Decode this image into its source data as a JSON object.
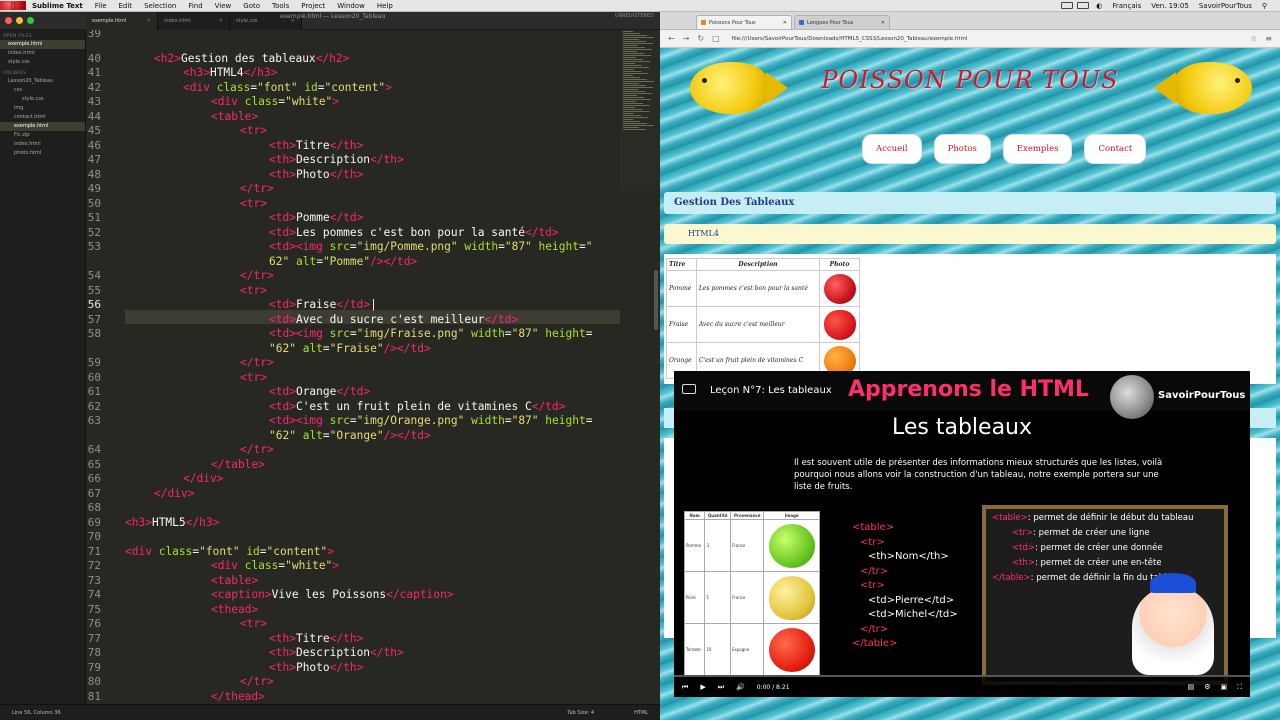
{
  "menubar": {
    "app": "Sublime Text",
    "items": [
      "File",
      "Edit",
      "Selection",
      "Find",
      "View",
      "Goto",
      "Tools",
      "Project",
      "Window",
      "Help"
    ],
    "language": "Français",
    "clock": "Ven. 19:05",
    "user": "SavoirPourTous"
  },
  "sublime": {
    "window_title": "exemple.html — Lesson20_Tableau",
    "unregistered": "UNREGISTERED",
    "tabs": [
      "exemple.html",
      "index.html",
      "style.css"
    ],
    "sidebar": {
      "open_files_label": "OPEN FILES",
      "open_files": [
        "exemple.html",
        "index.html",
        "style.css"
      ],
      "folders_label": "FOLDERS",
      "tree": [
        "Lesson20_Tableau",
        "css",
        "style.css",
        "img",
        "contact.html",
        "exemple.html",
        "Fic.zip",
        "index.html",
        "photo.html"
      ]
    },
    "line_numbers": [
      "39",
      "40",
      "41",
      "42",
      "43",
      "44",
      "45",
      "46",
      "47",
      "48",
      "49",
      "50",
      "51",
      "52",
      "53",
      "",
      "54",
      "55",
      "56",
      "57",
      "58",
      "",
      "59",
      "60",
      "61",
      "62",
      "63",
      "",
      "64",
      "65",
      "66",
      "67",
      "68",
      "69",
      "70",
      "71",
      "72",
      "73",
      "74",
      "75",
      "76",
      "77",
      "78",
      "79",
      "80",
      "81"
    ],
    "code": {
      "l40": "Gestion des tableaux",
      "l41": "HTML4",
      "l42": "\"font\"",
      "l42b": "\"content\"",
      "l43": "\"white\"",
      "l46": "Titre",
      "l47": "Description",
      "l48": "Photo",
      "l51": "Pomme",
      "l52": "Les pommes c'est bon pour la santé",
      "l53a": "\"img/Pomme.png\"",
      "l53b": "\"87\"",
      "l53c": "\"",
      "l53d": "62\"",
      "l53e": "\"Pomme\"",
      "l56": "Fraise",
      "l57": "Avec du sucre c'est meilleur",
      "l58a": "\"img/Fraise.png\"",
      "l58b": "\"87\"",
      "l58d": "\"62\"",
      "l58e": "\"Fraise\"",
      "l61": "Orange",
      "l62": "C'est un fruit plein de vitamines C",
      "l63a": "\"img/Orange.png\"",
      "l63b": "\"87\"",
      "l63d": "\"62\"",
      "l63e": "\"Orange\"",
      "l69": "HTML5",
      "l71a": "\"font\"",
      "l71b": "\"content\"",
      "l72": "\"white\"",
      "l74": "Vive les Poissons",
      "l77": "Titre",
      "l78": "Description",
      "l79": "Photo"
    },
    "status_left": "Line 56, Column 36",
    "status_tabsize": "Tab Size: 4",
    "status_syntax": "HTML"
  },
  "browser": {
    "tabs": [
      "Poissons Pour Tous",
      "Langues Pour Tous"
    ],
    "url": "file:///Users/SavoirPourTous/Downloads/HTML5_CSS3/Lesson20_Tableau/exemple.html"
  },
  "page": {
    "title": "POISSON POUR TOUS",
    "nav": [
      "Accueil",
      "Photos",
      "Exemples",
      "Contact"
    ],
    "heading": "Gestion Des Tableaux",
    "subheading": "HTML4",
    "table": {
      "headers": [
        "Titre",
        "Description",
        "Photo"
      ],
      "rows": [
        {
          "title": "Pomme",
          "desc": "Les pommes c'est bon pour la santé"
        },
        {
          "title": "Fraise",
          "desc": "Avec du sucre c'est meilleur"
        },
        {
          "title": "Orange",
          "desc": "C'est un fruit plein de vitamines C"
        }
      ]
    }
  },
  "video": {
    "lesson": "Leçon N°7: Les tableaux",
    "headline": "Apprenons le HTML",
    "brand": "SavoirPourTous",
    "subtitle": "Les tableaux",
    "paragraph": "Il est souvent utile de présenter des informations mieux structurés que les listes, voilà pourquoi nous allons voir la construction d'un tableau, notre exemple portera sur une liste de fruits.",
    "table_headers": [
      "Nom",
      "Quantité",
      "Provenance",
      "Image"
    ],
    "table_rows": [
      {
        "nom": "Pomme",
        "qte": "3",
        "prov": "France"
      },
      {
        "nom": "Poire",
        "qte": "5",
        "prov": "France"
      },
      {
        "nom": "Tomate",
        "qte": "10",
        "prov": "Espagne"
      }
    ],
    "code_lines": [
      "<table>",
      "<tr>",
      "<th>Nom</th>",
      "</tr>",
      "<tr>",
      "<td>Pierre</td>",
      "<td>Michel</td>",
      "</tr>",
      "</table>"
    ],
    "board": [
      {
        "tag": "<table>",
        "text": ": permet de définir le début du tableau"
      },
      {
        "tag": "<tr>",
        "text": ": permet de créer une ligne"
      },
      {
        "tag": "<td>",
        "text": ": permet de créer une donnée"
      },
      {
        "tag": "<th>",
        "text": ": permet de créer une en-tête"
      },
      {
        "tag": "</table>",
        "text": ": permet de définir la fin du tableau"
      }
    ],
    "time": "0:00 / 8:21",
    "progress": 0
  }
}
